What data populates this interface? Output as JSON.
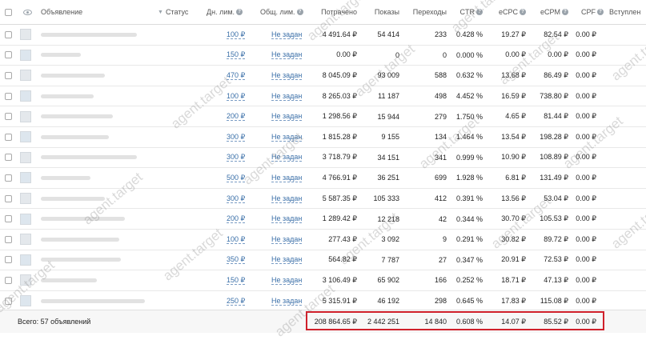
{
  "header": {
    "ad": "Объявление",
    "status": "Статус",
    "daily_limit": "Дн. лим.",
    "total_limit": "Общ. лим.",
    "spent": "Потрачено",
    "impressions": "Показы",
    "clicks": "Переходы",
    "ctr": "CTR",
    "ecpc": "eCPC",
    "ecpm": "eCPM",
    "cpf": "CPF",
    "joined": "Вступлен"
  },
  "rows": [
    {
      "daily": "100 ₽",
      "total": "Не задан",
      "spent": "4 491.64 ₽",
      "impr": "54 414",
      "clicks": "233",
      "ctr": "0.428 %",
      "ecpc": "19.27 ₽",
      "ecpm": "82.54 ₽",
      "cpf": "0.00 ₽"
    },
    {
      "daily": "150 ₽",
      "total": "Не задан",
      "spent": "0.00 ₽",
      "impr": "0",
      "clicks": "0",
      "ctr": "0.000 %",
      "ecpc": "0.00 ₽",
      "ecpm": "0.00 ₽",
      "cpf": "0.00 ₽"
    },
    {
      "daily": "470 ₽",
      "total": "Не задан",
      "spent": "8 045.09 ₽",
      "impr": "93 009",
      "clicks": "588",
      "ctr": "0.632 %",
      "ecpc": "13.68 ₽",
      "ecpm": "86.49 ₽",
      "cpf": "0.00 ₽"
    },
    {
      "daily": "100 ₽",
      "total": "Не задан",
      "spent": "8 265.03 ₽",
      "impr": "11 187",
      "clicks": "498",
      "ctr": "4.452 %",
      "ecpc": "16.59 ₽",
      "ecpm": "738.80 ₽",
      "cpf": "0.00 ₽"
    },
    {
      "daily": "200 ₽",
      "total": "Не задан",
      "spent": "1 298.56 ₽",
      "impr": "15 944",
      "clicks": "279",
      "ctr": "1.750 %",
      "ecpc": "4.65 ₽",
      "ecpm": "81.44 ₽",
      "cpf": "0.00 ₽"
    },
    {
      "daily": "300 ₽",
      "total": "Не задан",
      "spent": "1 815.28 ₽",
      "impr": "9 155",
      "clicks": "134",
      "ctr": "1.464 %",
      "ecpc": "13.54 ₽",
      "ecpm": "198.28 ₽",
      "cpf": "0.00 ₽"
    },
    {
      "daily": "300 ₽",
      "total": "Не задан",
      "spent": "3 718.79 ₽",
      "impr": "34 151",
      "clicks": "341",
      "ctr": "0.999 %",
      "ecpc": "10.90 ₽",
      "ecpm": "108.89 ₽",
      "cpf": "0.00 ₽"
    },
    {
      "daily": "500 ₽",
      "total": "Не задан",
      "spent": "4 766.91 ₽",
      "impr": "36 251",
      "clicks": "699",
      "ctr": "1.928 %",
      "ecpc": "6.81 ₽",
      "ecpm": "131.49 ₽",
      "cpf": "0.00 ₽"
    },
    {
      "daily": "300 ₽",
      "total": "Не задан",
      "spent": "5 587.35 ₽",
      "impr": "105 333",
      "clicks": "412",
      "ctr": "0.391 %",
      "ecpc": "13.56 ₽",
      "ecpm": "53.04 ₽",
      "cpf": "0.00 ₽"
    },
    {
      "daily": "200 ₽",
      "total": "Не задан",
      "spent": "1 289.42 ₽",
      "impr": "12 218",
      "clicks": "42",
      "ctr": "0.344 %",
      "ecpc": "30.70 ₽",
      "ecpm": "105.53 ₽",
      "cpf": "0.00 ₽"
    },
    {
      "daily": "100 ₽",
      "total": "Не задан",
      "spent": "277.43 ₽",
      "impr": "3 092",
      "clicks": "9",
      "ctr": "0.291 %",
      "ecpc": "30.82 ₽",
      "ecpm": "89.72 ₽",
      "cpf": "0.00 ₽"
    },
    {
      "daily": "350 ₽",
      "total": "Не задан",
      "spent": "564.82 ₽",
      "impr": "7 787",
      "clicks": "27",
      "ctr": "0.347 %",
      "ecpc": "20.91 ₽",
      "ecpm": "72.53 ₽",
      "cpf": "0.00 ₽"
    },
    {
      "daily": "150 ₽",
      "total": "Не задан",
      "spent": "3 106.49 ₽",
      "impr": "65 902",
      "clicks": "166",
      "ctr": "0.252 %",
      "ecpc": "18.71 ₽",
      "ecpm": "47.13 ₽",
      "cpf": "0.00 ₽"
    },
    {
      "daily": "250 ₽",
      "total": "Не задан",
      "spent": "5 315.91 ₽",
      "impr": "46 192",
      "clicks": "298",
      "ctr": "0.645 %",
      "ecpc": "17.83 ₽",
      "ecpm": "115.08 ₽",
      "cpf": "0.00 ₽"
    }
  ],
  "footer": {
    "count": "Всего: 57 объявлений",
    "spent": "208 864.65 ₽",
    "impr": "2 442 251",
    "clicks": "14 840",
    "ctr": "0.608 %",
    "ecpc": "14.07 ₽",
    "ecpm": "85.52 ₽",
    "cpf": "0.00 ₽"
  },
  "watermark": "agent.target",
  "colors": {
    "link": "#3a6fa8",
    "highlight": "#d0202b"
  }
}
